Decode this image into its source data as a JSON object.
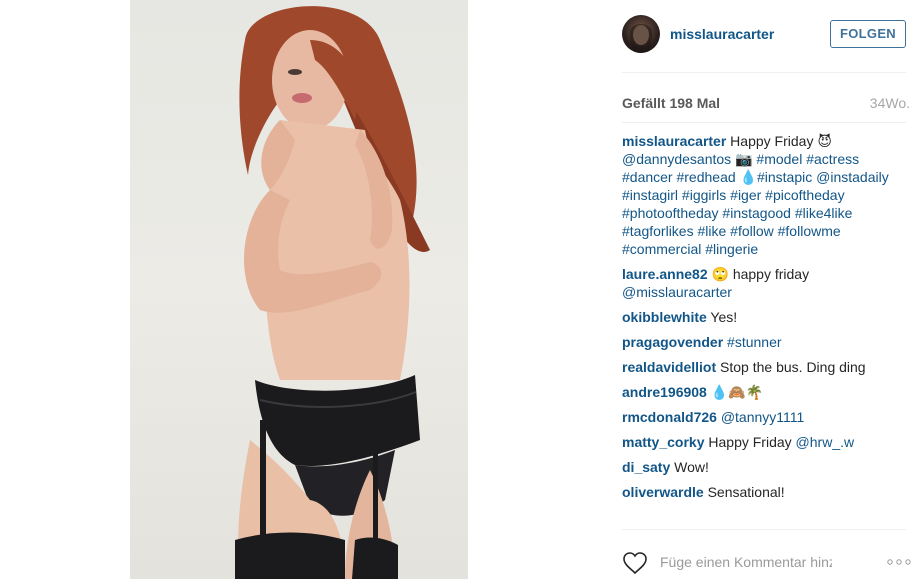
{
  "post": {
    "username": "misslauracarter",
    "follow_label": "FOLGEN",
    "likes_label": "Gefällt 198 Mal",
    "time_label": "34Wo.",
    "add_comment_placeholder": "Füge einen Kommentar hinzu ..."
  },
  "icons": {
    "heart": "heart-icon",
    "more": "more-options-icon",
    "avatar": "avatar"
  },
  "caption": {
    "username": "misslauracarter",
    "text_a": " Happy Friday 😈 ",
    "mention": "@dannydesantos",
    "text_b": " 📷 ",
    "tags_a": "#model #actress #dancer #redhead",
    "text_c": " 💧",
    "tags_b": "#instapic @instadaily #instagirl #iggirls #iger #picoftheday #photooftheday #instagood #like4like #tagforlikes #like #follow #followme #commercial #lingerie"
  },
  "comments": [
    {
      "user": "laure.anne82",
      "text": " 🙄 happy friday ",
      "tag": "@misslauracarter"
    },
    {
      "user": "okibblewhite",
      "text": " Yes!",
      "tag": ""
    },
    {
      "user": "pragagovender",
      "text": " ",
      "tag": "#stunner"
    },
    {
      "user": "realdavidelliot",
      "text": " Stop the bus. Ding ding",
      "tag": ""
    },
    {
      "user": "andre196908",
      "text": " 💧🙈🌴",
      "tag": ""
    },
    {
      "user": "rmcdonald726",
      "text": " ",
      "tag": "@tannyy1111"
    },
    {
      "user": "matty_corky",
      "text": " Happy Friday ",
      "tag": "@hrw_.w"
    },
    {
      "user": "di_saty",
      "text": " Wow!",
      "tag": ""
    },
    {
      "user": "oliverwardle",
      "text": " Sensational!",
      "tag": ""
    }
  ],
  "colors": {
    "link": "#125688",
    "follow_border": "#3f729b",
    "divider": "#efefef",
    "muted": "#a5a7aa"
  }
}
